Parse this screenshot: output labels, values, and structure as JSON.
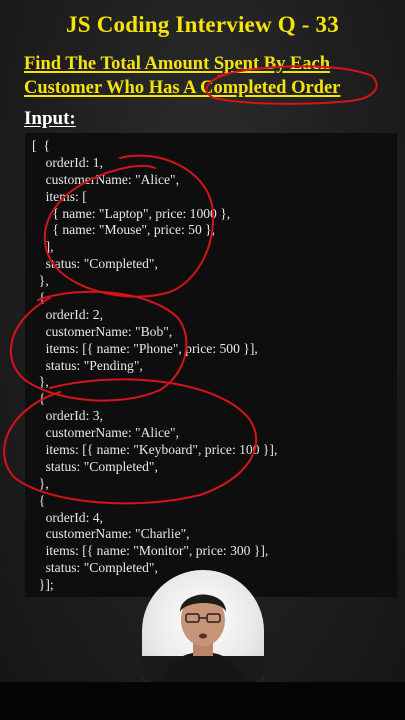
{
  "title": "JS Coding Interview Q - 33",
  "question": {
    "line1": "Find The Total Amount Spent By Each",
    "line2": "Customer Who Has A Completed Order"
  },
  "input_label": "Input:",
  "code_lines": [
    "[  {",
    "    orderId: 1,",
    "    customerName: \"Alice\",",
    "    items: [",
    "      { name: \"Laptop\", price: 1000 },",
    "      { name: \"Mouse\", price: 50 },",
    "    ],",
    "    status: \"Completed\",",
    "  },",
    "  {",
    "    orderId: 2,",
    "    customerName: \"Bob\",",
    "    items: [{ name: \"Phone\", price: 500 }],",
    "    status: \"Pending\",",
    "  },",
    "  {",
    "    orderId: 3,",
    "    customerName: \"Alice\",",
    "    items: [{ name: \"Keyboard\", price: 100 }],",
    "    status: \"Completed\",",
    "  },",
    "  {",
    "    orderId: 4,",
    "    customerName: \"Charlie\",",
    "    items: [{ name: \"Monitor\", price: 300 }],",
    "    status: \"Completed\",",
    "  }];"
  ],
  "colors": {
    "title": "#f4e40c",
    "annotation": "#d4141a",
    "code_bg": "#0e0e0e"
  },
  "presenter": "presenter-avatar"
}
